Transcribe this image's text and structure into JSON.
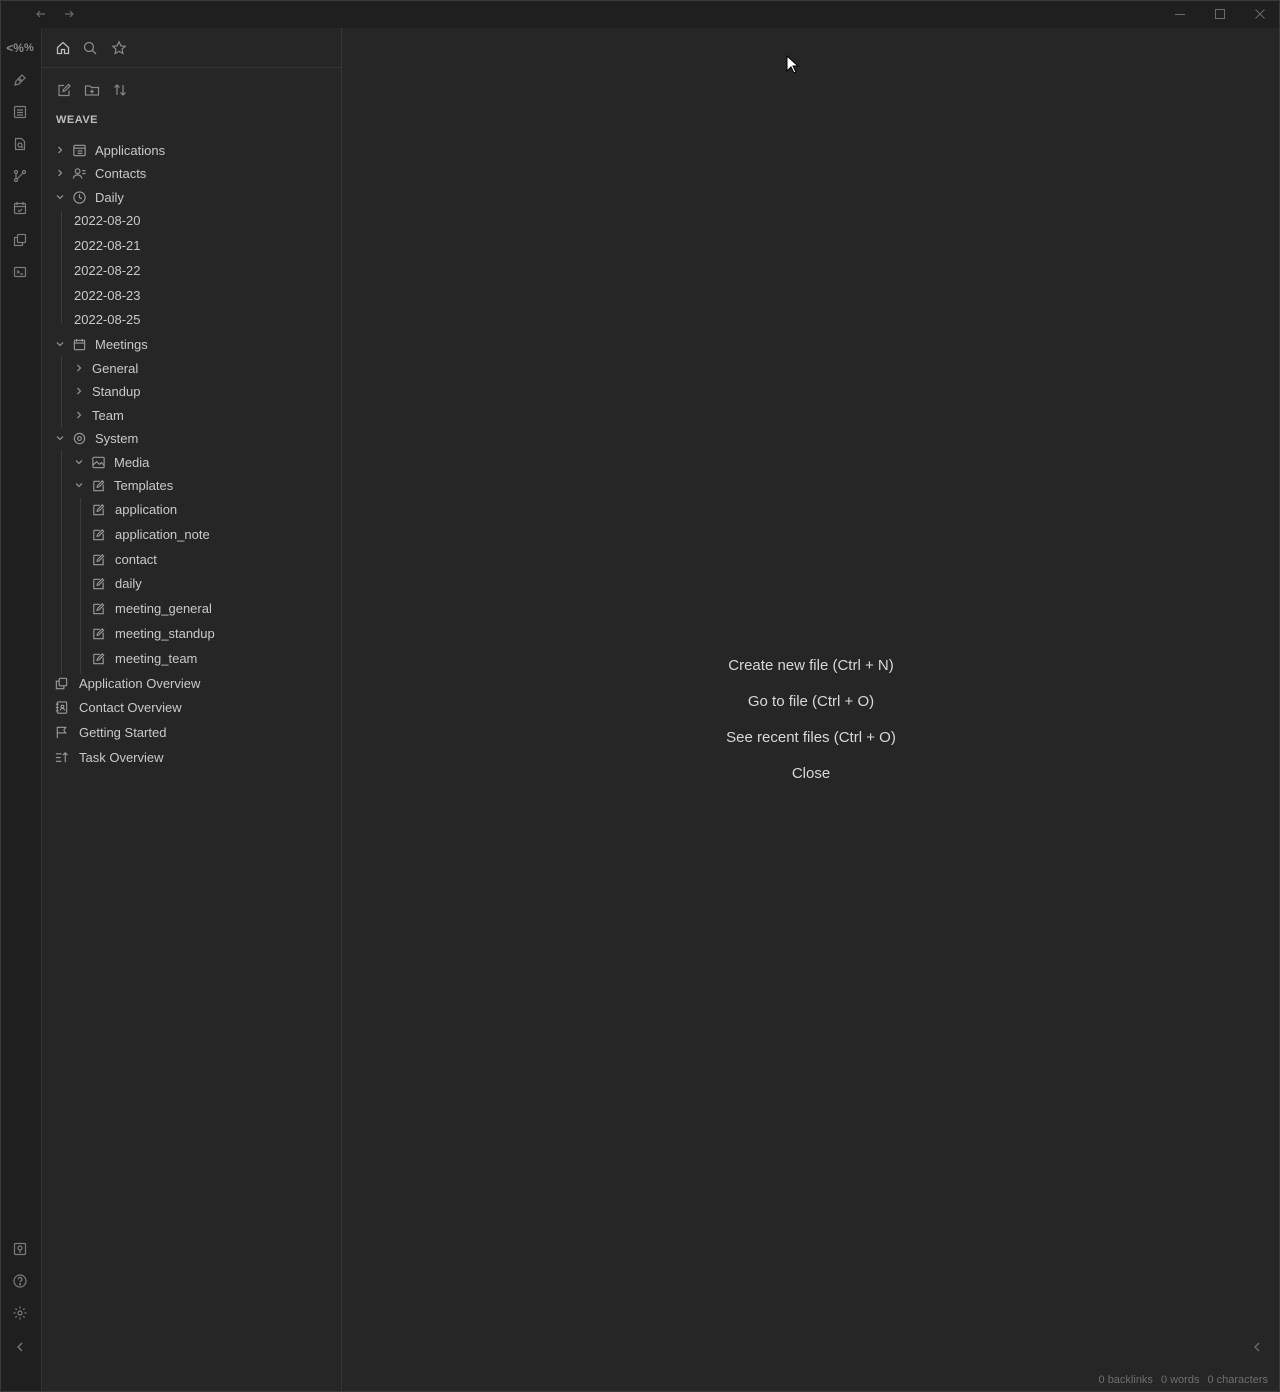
{
  "titlebar": {
    "icons": [
      "arrow-left-icon",
      "arrow-right-icon",
      "window-minimize-icon",
      "window-maximize-icon",
      "window-close-icon"
    ]
  },
  "ribbon": {
    "top_icons": [
      "templater-icon",
      "pen-icon",
      "table-icon",
      "search-doc-icon",
      "graph-icon",
      "calendar-check-icon",
      "copy-icon",
      "terminal-icon"
    ],
    "bottom_icons": [
      "vault-icon",
      "help-icon",
      "settings-icon",
      "collapse-left-icon"
    ],
    "templater_glyph": "<%"
  },
  "sidebar": {
    "tabs": [
      "home-icon",
      "search-icon",
      "star-icon"
    ],
    "tools": [
      "new-note-icon",
      "new-folder-icon",
      "sort-icon"
    ],
    "vault_name": "WEAVE",
    "tree": {
      "applications": "Applications",
      "contacts": "Contacts",
      "daily": "Daily",
      "daily_items": [
        "2022-08-20",
        "2022-08-21",
        "2022-08-22",
        "2022-08-23",
        "2022-08-25"
      ],
      "meetings": "Meetings",
      "meetings_items": [
        "General",
        "Standup",
        "Team"
      ],
      "system": "System",
      "media": "Media",
      "templates": "Templates",
      "template_items": [
        "application",
        "application_note",
        "contact",
        "daily",
        "meeting_general",
        "meeting_standup",
        "meeting_team"
      ],
      "root_files": [
        "Application Overview",
        "Contact Overview",
        "Getting Started",
        "Task Overview"
      ]
    }
  },
  "main": {
    "actions": {
      "create": "Create new file (Ctrl + N)",
      "goto": "Go to file (Ctrl + O)",
      "recent": "See recent files (Ctrl + O)",
      "close": "Close"
    },
    "status": {
      "backlinks": "0 backlinks",
      "words": "0 words",
      "characters": "0 characters"
    }
  },
  "colors": {
    "background": "#262626",
    "chrome": "#1f1f1f",
    "text": "#c9c9c9",
    "muted": "#7c7c7c"
  }
}
